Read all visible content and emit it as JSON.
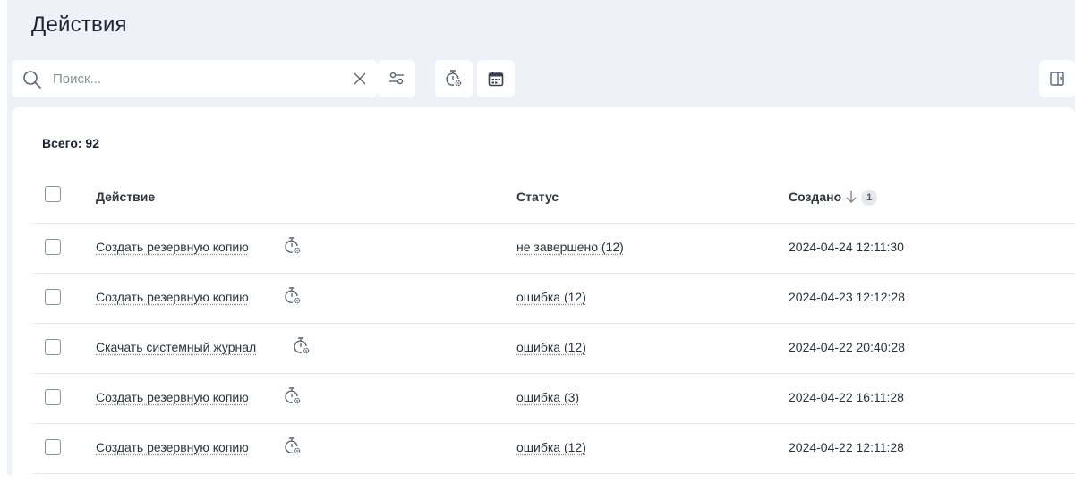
{
  "page": {
    "title": "Действия"
  },
  "search": {
    "placeholder": "Поиск...",
    "value": ""
  },
  "toolbar": {
    "filter_icon": "filter-sliders-icon",
    "timer_icon": "timer-gear-icon",
    "calendar_icon": "calendar-icon",
    "columns_icon": "folder-columns-icon"
  },
  "summary": {
    "total_label": "Всего: 92"
  },
  "table": {
    "columns": {
      "action": "Действие",
      "status": "Статус",
      "created": "Создано"
    },
    "sort": {
      "column": "created",
      "direction": "desc",
      "order_badge": "1"
    },
    "rows": [
      {
        "action": "Создать резервную копию",
        "status": "не завершено (12)",
        "created": "2024-04-24 12:11:30"
      },
      {
        "action": "Создать резервную копию",
        "status": "ошибка (12)",
        "created": "2024-04-23 12:12:28"
      },
      {
        "action": "Скачать системный журнал",
        "status": "ошибка (12)",
        "created": "2024-04-22 20:40:28"
      },
      {
        "action": "Создать резервную копию",
        "status": "ошибка (3)",
        "created": "2024-04-22 16:11:28"
      },
      {
        "action": "Создать резервную копию",
        "status": "ошибка (12)",
        "created": "2024-04-22 12:11:28"
      }
    ]
  },
  "colors": {
    "background": "#eef1f8",
    "card": "#ffffff",
    "icon": "#5c6270",
    "accent": "#3a4150"
  }
}
